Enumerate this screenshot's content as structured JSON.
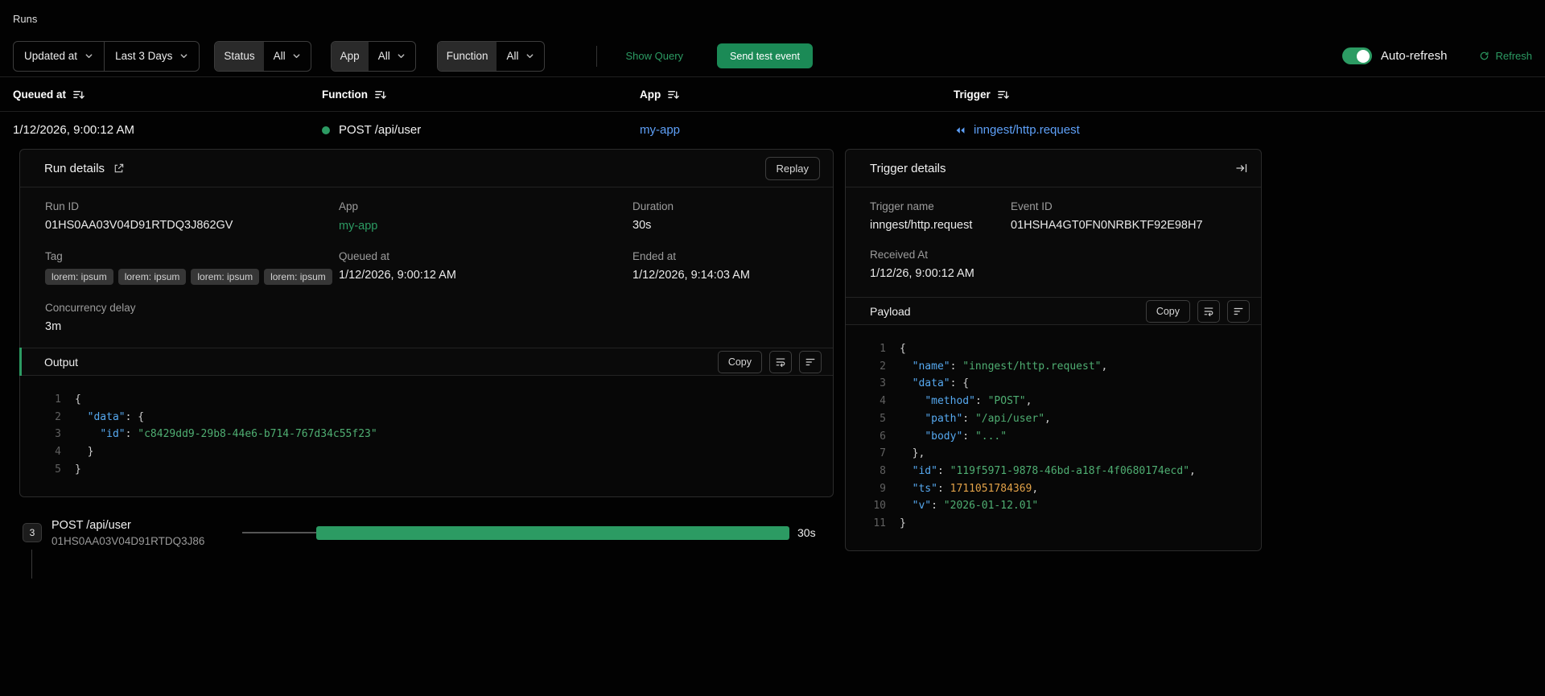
{
  "page": {
    "title": "Runs"
  },
  "colors": {
    "accent_green": "#2c9b63",
    "button_green": "#1b8a56",
    "link_blue": "#5ea0f8",
    "code_key": "#56a9f0",
    "code_string": "#4fae72",
    "code_number": "#e2a248"
  },
  "icons": {
    "chevron_down": "chevron-down",
    "sort": "sort-descending",
    "refresh": "circular-arrow",
    "external_link": "arrow-up-right-from-square",
    "word_wrap": "word-wrap-lines",
    "align_lines": "align-left-lines",
    "collapse_right": "arrow-to-right-bar",
    "trigger_event": "double-left-triangles",
    "status_dot": "green-circle"
  },
  "filters": {
    "sort_field": "Updated at",
    "time_range": "Last 3 Days",
    "status": {
      "label": "Status",
      "value": "All"
    },
    "app": {
      "label": "App",
      "value": "All"
    },
    "function": {
      "label": "Function",
      "value": "All"
    },
    "show_query": "Show Query",
    "send_test_event": "Send test event",
    "auto_refresh_label": "Auto-refresh",
    "auto_refresh_on": true,
    "refresh_label": "Refresh"
  },
  "table": {
    "columns": [
      "Queued at",
      "Function",
      "App",
      "Trigger"
    ],
    "row": {
      "queued_at": "1/12/2026, 9:00:12 AM",
      "function": "POST /api/user",
      "app": "my-app",
      "trigger": "inngest/http.request"
    }
  },
  "run_details": {
    "title": "Run details",
    "replay_label": "Replay",
    "run_id_label": "Run ID",
    "run_id": "01HS0AA03V04D91RTDQ3J862GV",
    "app_label": "App",
    "app": "my-app",
    "duration_label": "Duration",
    "duration": "30s",
    "tag_label": "Tag",
    "tags": [
      "lorem: ipsum",
      "lorem: ipsum",
      "lorem: ipsum",
      "lorem: ipsum"
    ],
    "queued_at_label": "Queued at",
    "queued_at": "1/12/2026, 9:00:12 AM",
    "ended_at_label": "Ended at",
    "ended_at": "1/12/2026, 9:14:03 AM",
    "concurrency_label": "Concurrency delay",
    "concurrency": "3m",
    "output": {
      "title": "Output",
      "copy_label": "Copy",
      "code": [
        [
          [
            "p",
            "{"
          ]
        ],
        [
          [
            "p",
            "  "
          ],
          [
            "k",
            "\"data\""
          ],
          [
            "p",
            ": {"
          ]
        ],
        [
          [
            "p",
            "    "
          ],
          [
            "k",
            "\"id\""
          ],
          [
            "p",
            ": "
          ],
          [
            "s",
            "\"c8429dd9-29b8-44e6-b714-767d34c55f23\""
          ]
        ],
        [
          [
            "p",
            "  }"
          ]
        ],
        [
          [
            "p",
            "}"
          ]
        ]
      ]
    }
  },
  "trigger_details": {
    "title": "Trigger details",
    "trigger_name_label": "Trigger name",
    "trigger_name": "inngest/http.request",
    "event_id_label": "Event ID",
    "event_id": "01HSHA4GT0FN0NRBKTF92E98H7",
    "received_at_label": "Received At",
    "received_at": "1/12/26, 9:00:12 AM",
    "payload": {
      "title": "Payload",
      "copy_label": "Copy",
      "code": [
        [
          [
            "p",
            "{"
          ]
        ],
        [
          [
            "p",
            "  "
          ],
          [
            "k",
            "\"name\""
          ],
          [
            "p",
            ": "
          ],
          [
            "s",
            "\"inngest/http.request\""
          ],
          [
            "p",
            ","
          ]
        ],
        [
          [
            "p",
            "  "
          ],
          [
            "k",
            "\"data\""
          ],
          [
            "p",
            ": {"
          ]
        ],
        [
          [
            "p",
            "    "
          ],
          [
            "k",
            "\"method\""
          ],
          [
            "p",
            ": "
          ],
          [
            "s",
            "\"POST\""
          ],
          [
            "p",
            ","
          ]
        ],
        [
          [
            "p",
            "    "
          ],
          [
            "k",
            "\"path\""
          ],
          [
            "p",
            ": "
          ],
          [
            "s",
            "\"/api/user\""
          ],
          [
            "p",
            ","
          ]
        ],
        [
          [
            "p",
            "    "
          ],
          [
            "k",
            "\"body\""
          ],
          [
            "p",
            ": "
          ],
          [
            "s",
            "\"...\""
          ]
        ],
        [
          [
            "p",
            "  },"
          ]
        ],
        [
          [
            "p",
            "  "
          ],
          [
            "k",
            "\"id\""
          ],
          [
            "p",
            ": "
          ],
          [
            "s",
            "\"119f5971-9878-46bd-a18f-4f0680174ecd\""
          ],
          [
            "p",
            ","
          ]
        ],
        [
          [
            "p",
            "  "
          ],
          [
            "k",
            "\"ts\""
          ],
          [
            "p",
            ": "
          ],
          [
            "n",
            "1711051784369"
          ],
          [
            "p",
            ","
          ]
        ],
        [
          [
            "p",
            "  "
          ],
          [
            "k",
            "\"v\""
          ],
          [
            "p",
            ": "
          ],
          [
            "s",
            "\"2026-01-12.01\""
          ]
        ],
        [
          [
            "p",
            "}"
          ]
        ]
      ]
    }
  },
  "timeline": {
    "step_count": "3",
    "step_name": "POST /api/user",
    "step_id": "01HS0AA03V04D91RTDQ3J86",
    "duration": "30s"
  }
}
